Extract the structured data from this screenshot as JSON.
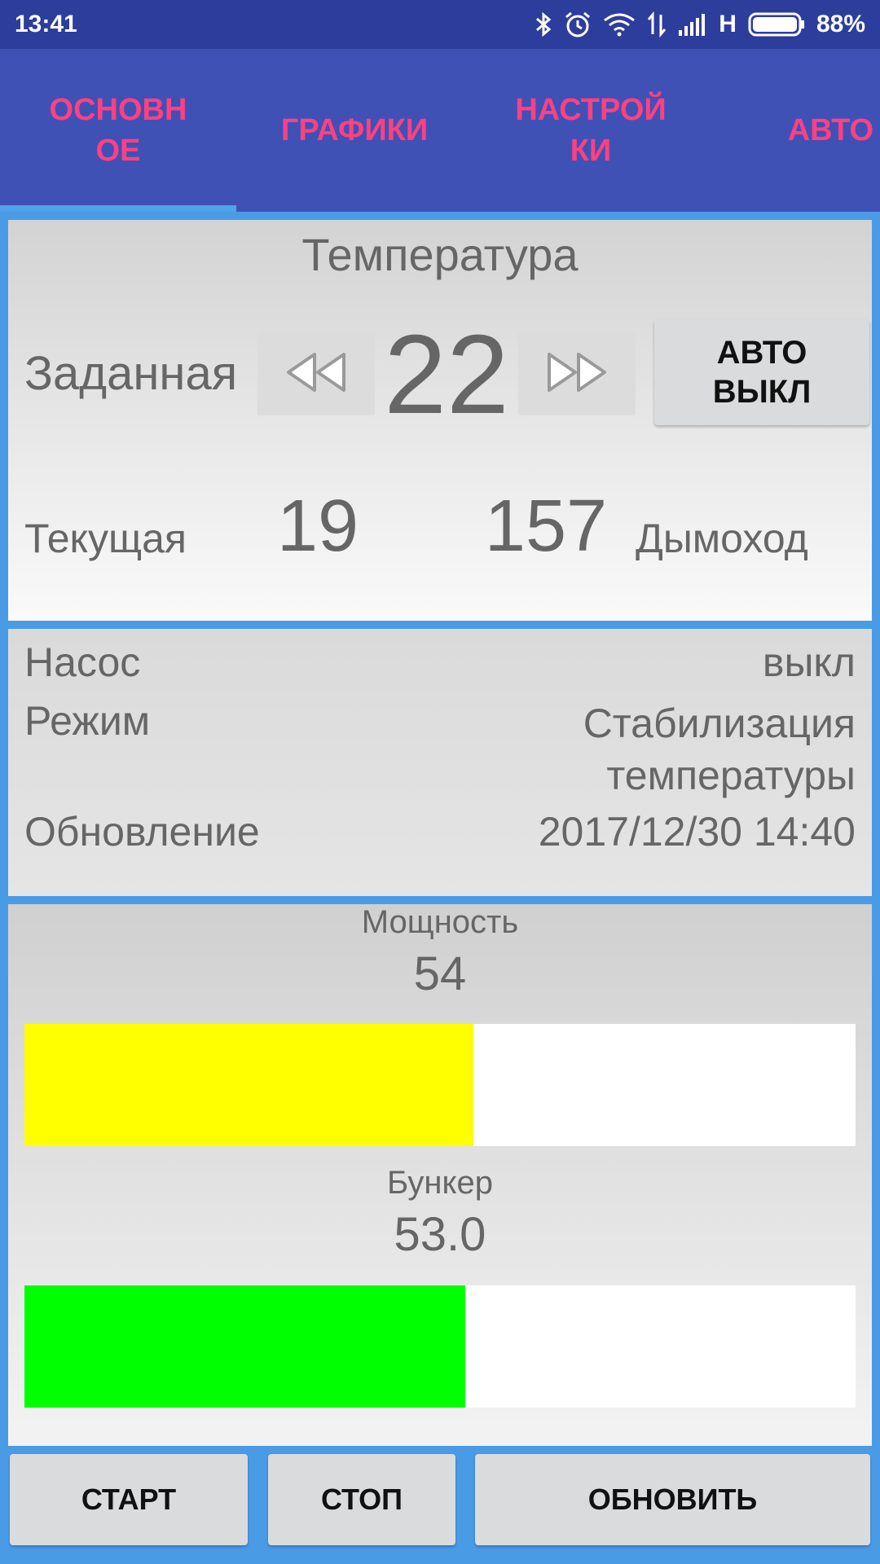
{
  "status": {
    "time": "13:41",
    "network": "H",
    "battery": "88%",
    "battery_level": 0.88
  },
  "tabs": [
    {
      "label": "ОСНОВН\nОЕ",
      "active": true
    },
    {
      "label": "ГРАФИКИ"
    },
    {
      "label": "НАСТРОЙ\nКИ"
    },
    {
      "label": "АВТО"
    }
  ],
  "temperature": {
    "title": "Температура",
    "setpoint_label": "Заданная",
    "setpoint_value": "22",
    "auto_button": "АВТО\nВЫКЛ",
    "current_label": "Текущая",
    "current_value": "19",
    "flue_value": "157",
    "flue_label": "Дымоход"
  },
  "info": {
    "pump_label": "Насос",
    "pump_value": "выкл",
    "mode_label": "Режим",
    "mode_value": "Стабилизация\nтемпературы",
    "update_label": "Обновление",
    "update_value": "2017/12/30 14:40"
  },
  "power": {
    "label": "Мощность",
    "value": "54",
    "fraction": 0.54,
    "color": "#ffff00"
  },
  "bunker": {
    "label": "Бункер",
    "value": "53.0",
    "fraction": 0.53,
    "color": "#00ff00"
  },
  "actions": {
    "start": "СТАРТ",
    "stop": "СТОП",
    "refresh": "ОБНОВИТЬ"
  },
  "icons": [
    "bluetooth-icon",
    "alarm-icon",
    "wifi-icon",
    "data-transfer-icon",
    "signal-icon",
    "battery-icon",
    "rewind-icon",
    "fast-forward-icon"
  ]
}
